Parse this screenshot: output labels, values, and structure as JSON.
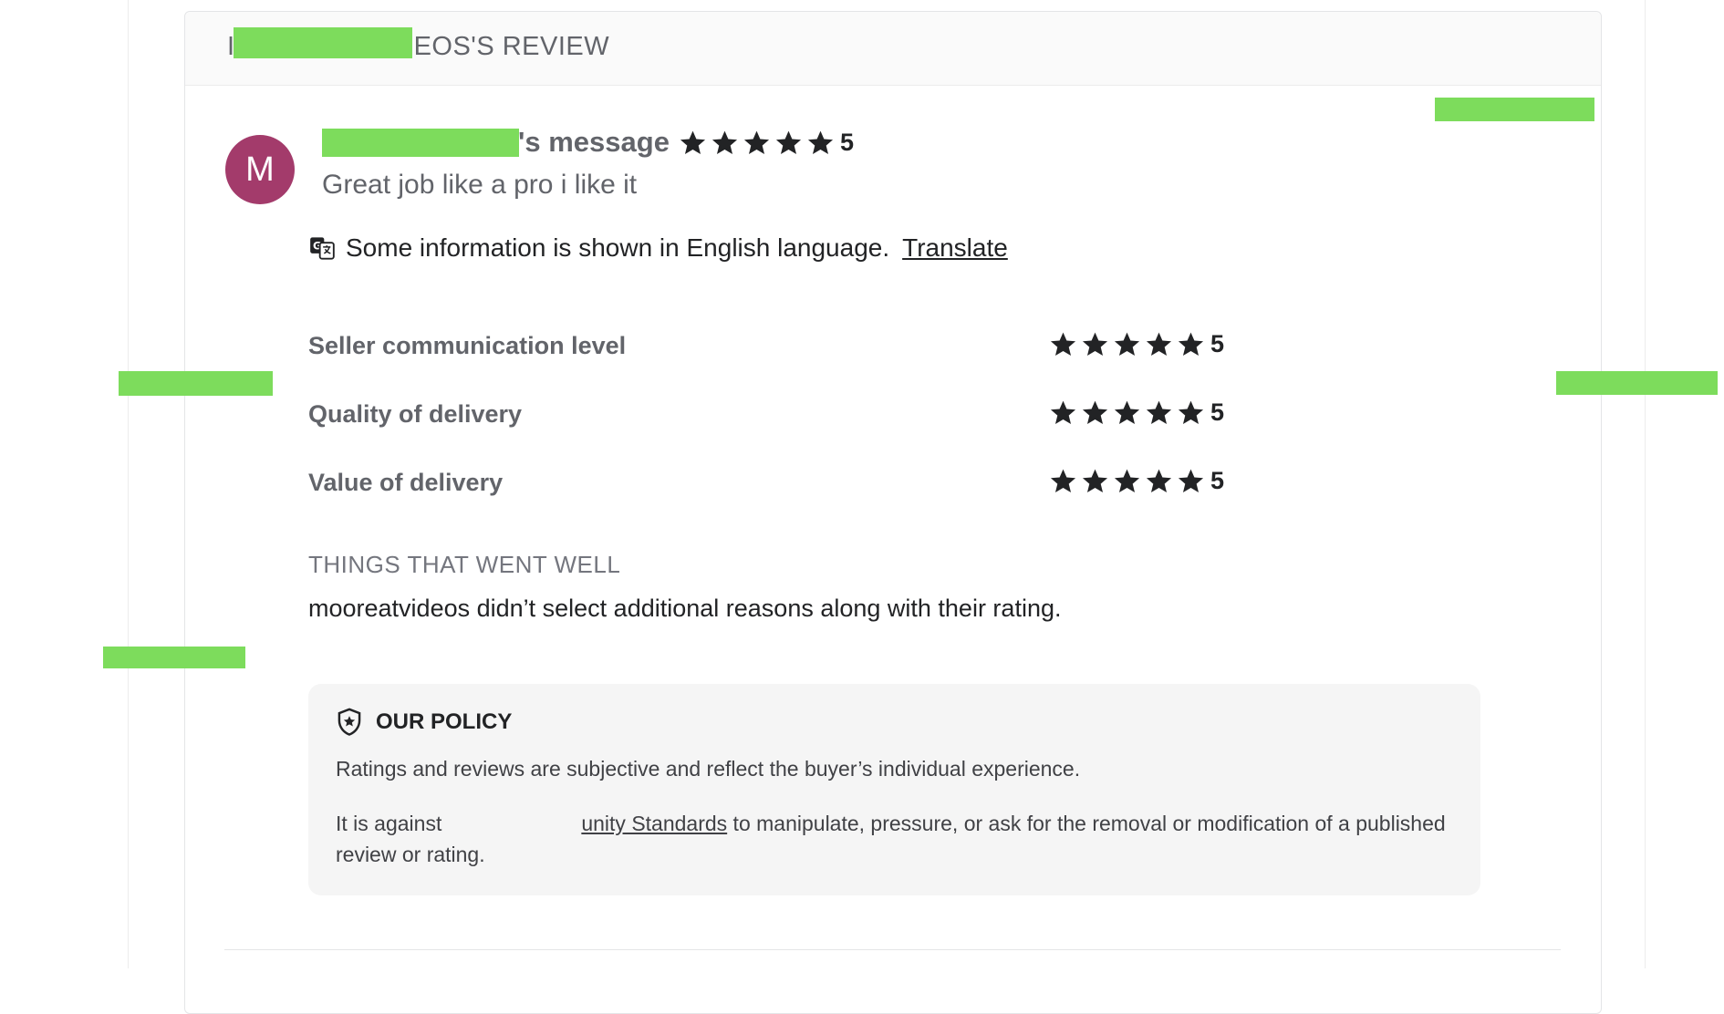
{
  "review": {
    "title_visible": "EOS'S REVIEW",
    "avatar_letter": "M",
    "message_suffix": "'s message",
    "overall_rating": "5",
    "review_text": "Great job like a pro i like it",
    "translate_notice": "Some information is shown in English language.",
    "translate_link": "Translate"
  },
  "criteria": [
    {
      "label": "Seller communication level",
      "rating": "5"
    },
    {
      "label": "Quality of delivery",
      "rating": "5"
    },
    {
      "label": "Value of delivery",
      "rating": "5"
    }
  ],
  "went_well": {
    "title": "THINGS THAT WENT WELL",
    "text": "mooreatvideos didn’t select additional reasons along with their rating."
  },
  "policy": {
    "title": "OUR POLICY",
    "p1": "Ratings and reviews are subjective and reflect the buyer’s individual experience.",
    "p2_prefix": "It is against",
    "p2_link_visible": "unity Standards",
    "p2_suffix": " to manipulate, pressure, or ask for the removal or modification of a published review or rating."
  },
  "colors": {
    "star": "#222325",
    "avatar": "#a33b6b",
    "redaction": "#7ddc5c"
  },
  "icons": [
    "star-icon",
    "translate-icon",
    "shield-star-icon"
  ]
}
